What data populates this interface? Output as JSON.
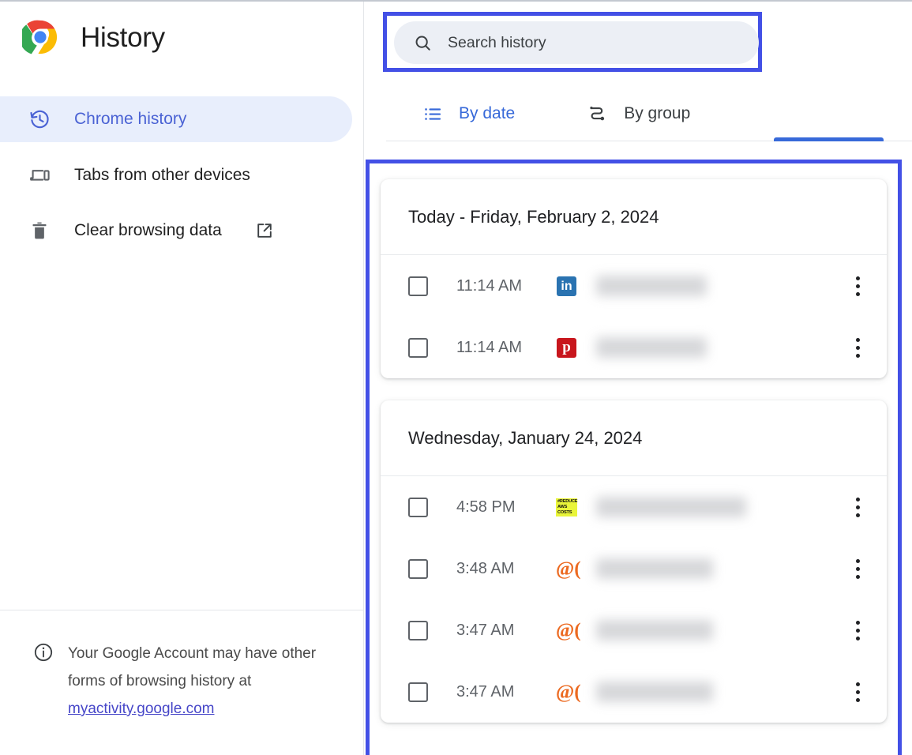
{
  "app": {
    "title": "History",
    "logo_icon": "chrome-logo-icon"
  },
  "sidebar": {
    "items": [
      {
        "label": "Chrome history",
        "icon": "history-clock-icon",
        "selected": true
      },
      {
        "label": "Tabs from other devices",
        "icon": "devices-icon",
        "selected": false
      },
      {
        "label": "Clear browsing data",
        "icon": "trash-icon",
        "selected": false,
        "trailing_icon": "external-link-icon"
      }
    ],
    "footer": {
      "icon": "info-icon",
      "text_before": "Your Google Account may have other forms of browsing history at ",
      "link_text": "myactivity.google.com"
    }
  },
  "search": {
    "icon": "search-icon",
    "placeholder": "Search history",
    "value": ""
  },
  "tabs": [
    {
      "label": "By date",
      "icon": "list-icon",
      "active": true
    },
    {
      "label": "By group",
      "icon": "journey-icon",
      "active": false
    }
  ],
  "history": {
    "cards": [
      {
        "header": "Today - Friday, February 2, 2024",
        "rows": [
          {
            "time": "11:14 AM",
            "favicon": "linkedin-favicon",
            "favicon_text": "in",
            "title_redacted": true,
            "redacted_width": 140,
            "menu_icon": "more-vertical-icon"
          },
          {
            "time": "11:14 AM",
            "favicon": "p-red-favicon",
            "favicon_text": "p",
            "title_redacted": true,
            "redacted_width": 140,
            "menu_icon": "more-vertical-icon"
          }
        ]
      },
      {
        "header": "Wednesday, January 24, 2024",
        "rows": [
          {
            "time": "4:58 PM",
            "favicon": "reduce-aws-costs-favicon",
            "favicon_text": "#REDUCE AWS COSTS",
            "title_redacted": true,
            "redacted_width": 190,
            "menu_icon": "more-vertical-icon"
          },
          {
            "time": "3:48 AM",
            "favicon": "at-paren-favicon",
            "favicon_text": "@(",
            "title_redacted": true,
            "redacted_width": 148,
            "menu_icon": "more-vertical-icon"
          },
          {
            "time": "3:47 AM",
            "favicon": "at-paren-favicon",
            "favicon_text": "@(",
            "title_redacted": true,
            "redacted_width": 148,
            "menu_icon": "more-vertical-icon"
          },
          {
            "time": "3:47 AM",
            "favicon": "at-paren-favicon",
            "favicon_text": "@(",
            "title_redacted": true,
            "redacted_width": 148,
            "menu_icon": "more-vertical-icon"
          }
        ]
      }
    ]
  },
  "colors": {
    "accent_blue": "#3769d9",
    "highlight_box": "#4350e6",
    "selected_pill_bg": "#e8eefc",
    "selected_pill_text": "#4a62d4",
    "link": "#4646c8",
    "text_primary": "#202124",
    "text_secondary": "#5f6368"
  }
}
